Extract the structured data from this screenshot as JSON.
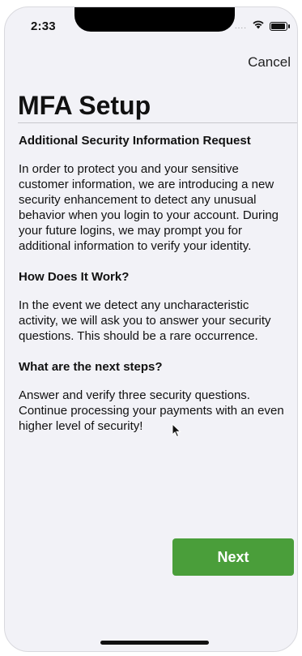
{
  "status_bar": {
    "time": "2:33",
    "signal": "....",
    "wifi_icon": "wifi-icon",
    "battery_icon": "battery-icon"
  },
  "nav": {
    "cancel_label": "Cancel"
  },
  "page": {
    "title": "MFA Setup"
  },
  "sections": [
    {
      "heading": "Additional Security Information Request",
      "body": "In order to protect you and your sensitive customer information, we are introducing a new security enhancement to detect any unusual behavior when you login to your account. During your future logins, we may prompt you for additional information to verify your identity."
    },
    {
      "heading": "How Does It Work?",
      "body": "In the event we detect any uncharacteristic activity, we will ask you to answer your security questions. This should be a rare occurrence."
    },
    {
      "heading": "What are the next steps?",
      "body": "Answer and verify three security questions. Continue processing your payments with an even higher level of security!"
    }
  ],
  "actions": {
    "next_label": "Next"
  },
  "colors": {
    "accent_green": "#4a9e3a",
    "background": "#f2f2f7"
  }
}
